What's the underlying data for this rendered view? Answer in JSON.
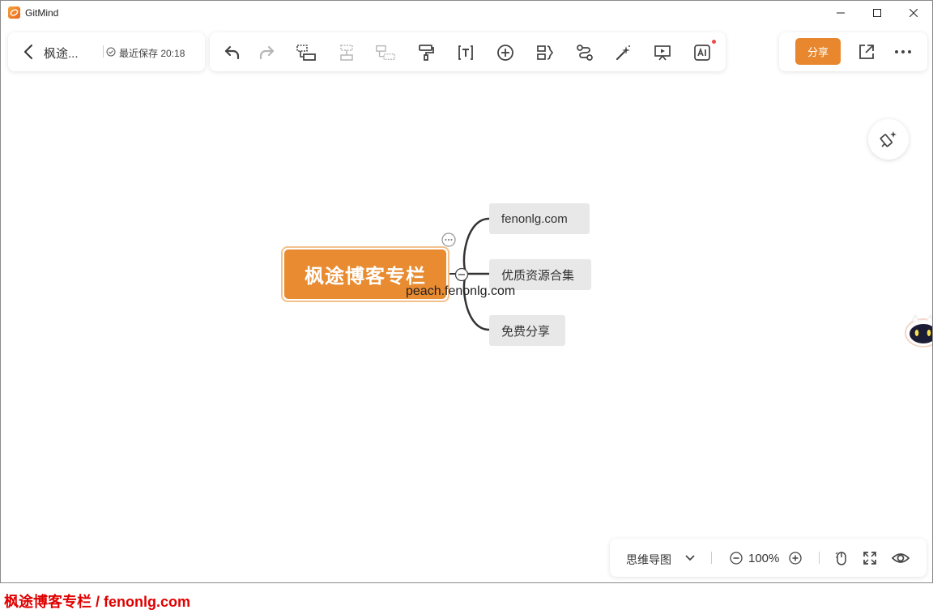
{
  "app": {
    "name": "GitMind"
  },
  "header": {
    "doc_title": "枫途...",
    "save_status": "最近保存 20:18"
  },
  "toolbar": {
    "items": [
      "undo-icon",
      "redo-icon",
      "insert-child-icon",
      "insert-sibling-icon",
      "insert-parent-icon",
      "format-painter-icon",
      "text-icon",
      "add-icon",
      "summary-icon",
      "relation-icon",
      "magic-style-icon",
      "presentation-icon",
      "ai-icon"
    ]
  },
  "actions": {
    "share_label": "分享"
  },
  "mindmap": {
    "root": "枫途博客专栏",
    "children": [
      "fenonlg.com",
      "优质资源合集",
      "免费分享"
    ],
    "overlay_text": "peach.fenonlg.com"
  },
  "bottom": {
    "layout_label": "思维导图",
    "zoom": "100%"
  },
  "footer": {
    "watermark": "枫途博客专栏 / fenonlg.com"
  },
  "colors": {
    "accent": "#e8872e",
    "node_bg": "#e8e8e8",
    "watermark": "#e00000"
  }
}
